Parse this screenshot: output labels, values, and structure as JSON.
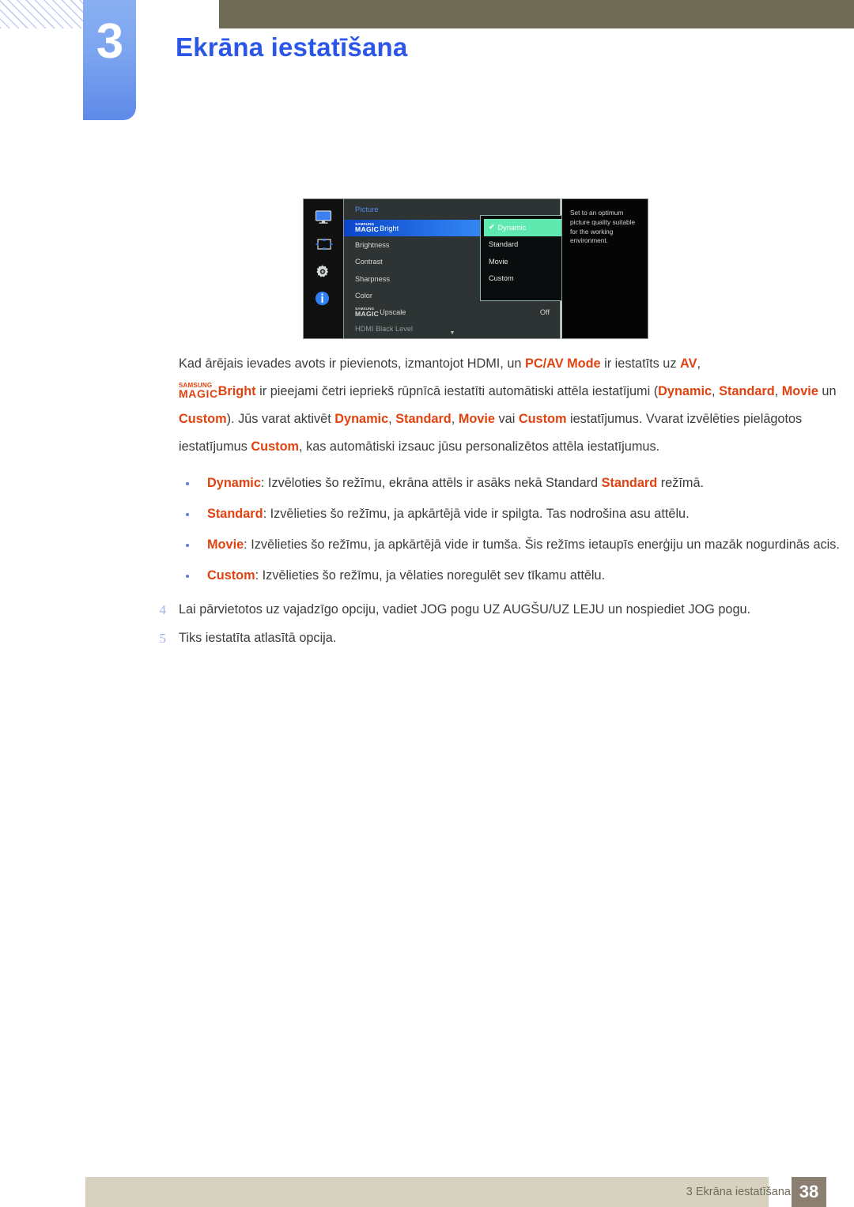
{
  "header": {
    "chapter_number": "3",
    "title": "Ekrāna iestatīšana"
  },
  "osd": {
    "sidebar_icons": [
      "monitor-icon",
      "move-arrows-icon",
      "gear-icon",
      "info-icon"
    ],
    "menu_title": "Picture",
    "items": [
      {
        "magic": true,
        "prefix_top": "SAMSUNG",
        "prefix_bottom": "MAGIC",
        "label": "Bright",
        "value": "",
        "selected": true,
        "dim": false
      },
      {
        "magic": false,
        "label": "Brightness",
        "value": "",
        "selected": false,
        "dim": false
      },
      {
        "magic": false,
        "label": "Contrast",
        "value": "",
        "selected": false,
        "dim": false
      },
      {
        "magic": false,
        "label": "Sharpness",
        "value": "",
        "selected": false,
        "dim": false
      },
      {
        "magic": false,
        "label": "Color",
        "value": "",
        "selected": false,
        "dim": false
      },
      {
        "magic": true,
        "prefix_top": "SAMSUNG",
        "prefix_bottom": "MAGIC",
        "label": "Upscale",
        "value": "Off",
        "selected": false,
        "dim": false
      },
      {
        "magic": false,
        "label": "HDMI Black Level",
        "value": "",
        "selected": false,
        "dim": true
      }
    ],
    "scroll_chevron": "▼",
    "submenu": {
      "options": [
        {
          "label": "Dynamic",
          "selected": true
        },
        {
          "label": "Standard",
          "selected": false
        },
        {
          "label": "Movie",
          "selected": false
        },
        {
          "label": "Custom",
          "selected": false
        }
      ],
      "check_glyph": "✔"
    },
    "help_text": "Set to an optimum picture quality suitable for the working environment."
  },
  "body": {
    "para1": {
      "t1": "Kad ārējais ievades avots ir pievienots, izmantojot HDMI, un ",
      "h1": "PC/AV Mode",
      "t2": " ir iestatīts uz ",
      "h2": "AV",
      "t3": ","
    },
    "para2": {
      "magic_top": "SAMSUNG",
      "magic_bottom": "MAGIC",
      "h0": "Bright",
      "t1": " ir pieejami četri iepriekš rūpnīcā iestatīti automātiski attēla iestatījumi (",
      "h1": "Dynamic",
      "t2": ", ",
      "h2": "Standard",
      "t3": ", ",
      "h3": "Movie",
      "t4": " un ",
      "h4": "Custom",
      "t5": "). Jūs varat aktivēt ",
      "h5": "Dynamic",
      "t6": ", ",
      "h6": "Standard",
      "t7": ", ",
      "h7": "Movie",
      "t8": " vai ",
      "h8": "Custom",
      "t9": " iestatījumus. Vvarat izvēlēties pielāgotos iestatījumus ",
      "h9": "Custom",
      "t10": ", kas automātiski izsauc jūsu personalizētos attēla iestatījumus."
    },
    "bullets": [
      {
        "term": "Dynamic",
        "text_before": ": Izvēloties šo režīmu, ekrāna attēls ir asāks nekā Standard ",
        "inline_term": "Standard",
        "text_after": " režīmā."
      },
      {
        "term": "Standard",
        "text_before": ": Izvēlieties šo režīmu, ja apkārtējā vide ir spilgta. Tas nodrošina asu attēlu.",
        "inline_term": "",
        "text_after": ""
      },
      {
        "term": "Movie",
        "text_before": ": Izvēlieties šo režīmu, ja apkārtējā vide ir tumša. Šis režīms ietaupīs enerģiju un mazāk nogurdinās acis.",
        "inline_term": "",
        "text_after": ""
      },
      {
        "term": "Custom",
        "text_before": ": Izvēlieties šo režīmu, ja vēlaties noregulēt sev tīkamu attēlu.",
        "inline_term": "",
        "text_after": ""
      }
    ],
    "steps": [
      {
        "num": "4",
        "text": "Lai pārvietotos uz vajadzīgo opciju, vadiet JOG pogu UZ AUGŠU/UZ LEJU un nospiediet JOG pogu."
      },
      {
        "num": "5",
        "text": "Tiks iestatīta atlasītā opcija."
      }
    ]
  },
  "footer": {
    "text": "3 Ekrāna iestatīšana",
    "page": "38"
  },
  "colors": {
    "title_blue": "#2c56e8",
    "olive": "#6d6a56",
    "highlight_orange": "#e04310",
    "osd_select_green": "#5fe8b0",
    "osd_select_blue": "#2f7ff0",
    "footer_bar": "#d7d2c0",
    "footer_page_box": "#8b7f72"
  }
}
